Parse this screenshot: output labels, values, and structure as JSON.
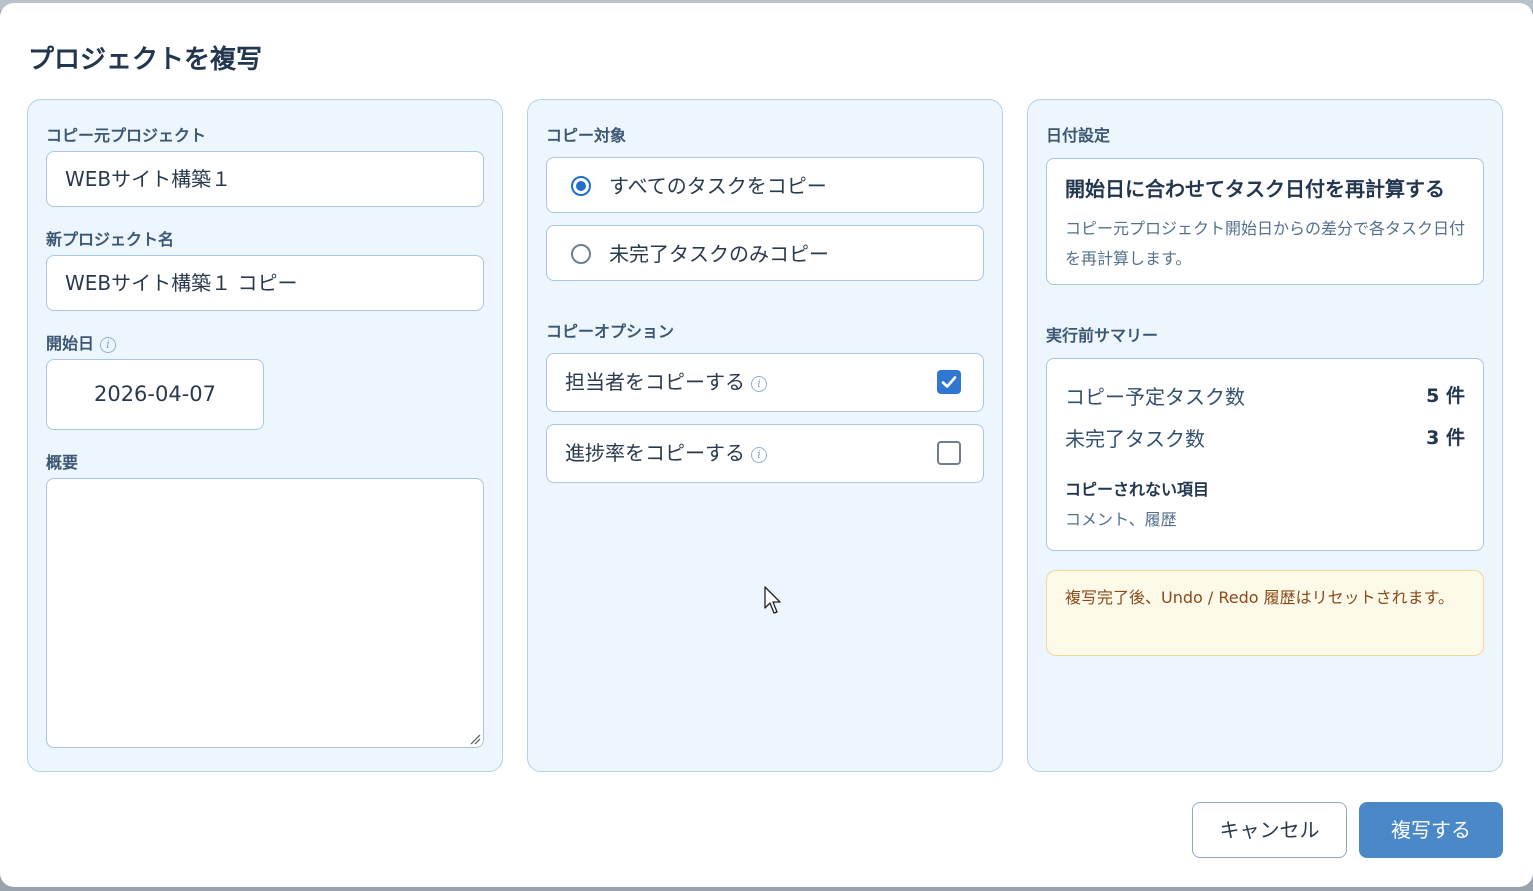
{
  "dialog": {
    "title": "プロジェクトを複写"
  },
  "source_panel": {
    "source_label": "コピー元プロジェクト",
    "source_value": "WEBサイト構築１",
    "new_name_label": "新プロジェクト名",
    "new_name_value": "WEBサイト構築１ コピー",
    "start_date_label": "開始日",
    "start_date_value": "2026-04-07",
    "summary_label": "概要",
    "summary_value": ""
  },
  "copy_panel": {
    "target_label": "コピー対象",
    "target_options": [
      {
        "label": "すべてのタスクをコピー",
        "selected": true
      },
      {
        "label": "未完了タスクのみコピー",
        "selected": false
      }
    ],
    "options_label": "コピーオプション",
    "options": [
      {
        "label": "担当者をコピーする",
        "checked": true
      },
      {
        "label": "進捗率をコピーする",
        "checked": false
      }
    ]
  },
  "date_panel": {
    "date_label": "日付設定",
    "recalc_title": "開始日に合わせてタスク日付を再計算する",
    "recalc_desc": "コピー元プロジェクト開始日からの差分で各タスク日付を再計算します。",
    "summary_label": "実行前サマリー",
    "rows": [
      {
        "label": "コピー予定タスク数",
        "value": "5 件"
      },
      {
        "label": "未完了タスク数",
        "value": "3 件"
      }
    ],
    "excluded_title": "コピーされない項目",
    "excluded_items": "コメント、履歴",
    "warning": "複写完了後、Undo / Redo 履歴はリセットされます。"
  },
  "footer": {
    "cancel_label": "キャンセル",
    "submit_label": "複写する"
  },
  "colors": {
    "panel_bg": "#edf5fd",
    "panel_border": "#b3d1ee",
    "primary": "#4b88c8",
    "checkbox_checked": "#2f77d0",
    "warning_bg": "#fefaea",
    "warning_text": "#8a4a1a"
  }
}
